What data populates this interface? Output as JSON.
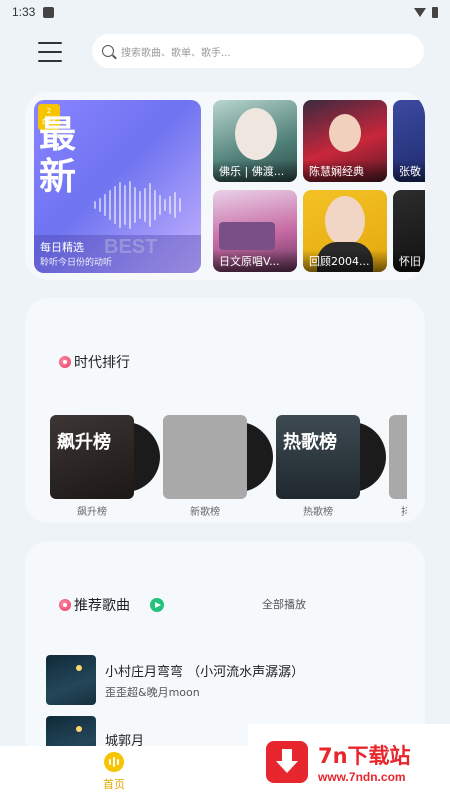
{
  "status_bar": {
    "time": "1:33"
  },
  "search": {
    "placeholder": "搜索歌曲、歌单、歌手..."
  },
  "banner": {
    "daily": {
      "badge_num": "2",
      "badge_unit": "DAY",
      "big_line1": "最",
      "big_line2": "新",
      "watermark_word": "BEST",
      "title": "每日精选",
      "subtitle": "聆听今日份的动听"
    },
    "tiles": [
      {
        "caption": "佛乐 | 佛渡..."
      },
      {
        "caption": "陈慧娴经典"
      },
      {
        "caption": "张敬"
      },
      {
        "caption": "日文原唱V..."
      },
      {
        "caption": "回顾2004..."
      },
      {
        "caption": "怀旧"
      }
    ]
  },
  "charts_section": {
    "title": "时代排行",
    "items": [
      {
        "cover_text": "飙升榜",
        "label": "飙升榜"
      },
      {
        "cover_text": "",
        "label": "新歌榜"
      },
      {
        "cover_text": "热歌榜",
        "label": "热歌榜"
      },
      {
        "cover_text": "",
        "label": "抖"
      }
    ]
  },
  "recommend_section": {
    "title": "推荐歌曲",
    "play_all": "全部播放",
    "songs": [
      {
        "name": "小村庄月弯弯 （小河流水声潺潺）",
        "artist": "歪歪超&晚月moon"
      },
      {
        "name": "城郭月",
        "artist": ""
      }
    ]
  },
  "bottom_nav": {
    "home_label": "首页"
  },
  "watermark": {
    "title": "7n下载站",
    "url": "www.7ndn.com"
  },
  "colors": {
    "accent": "#f7c400",
    "play_green": "#21c27a",
    "brand_red": "#e8262d"
  }
}
